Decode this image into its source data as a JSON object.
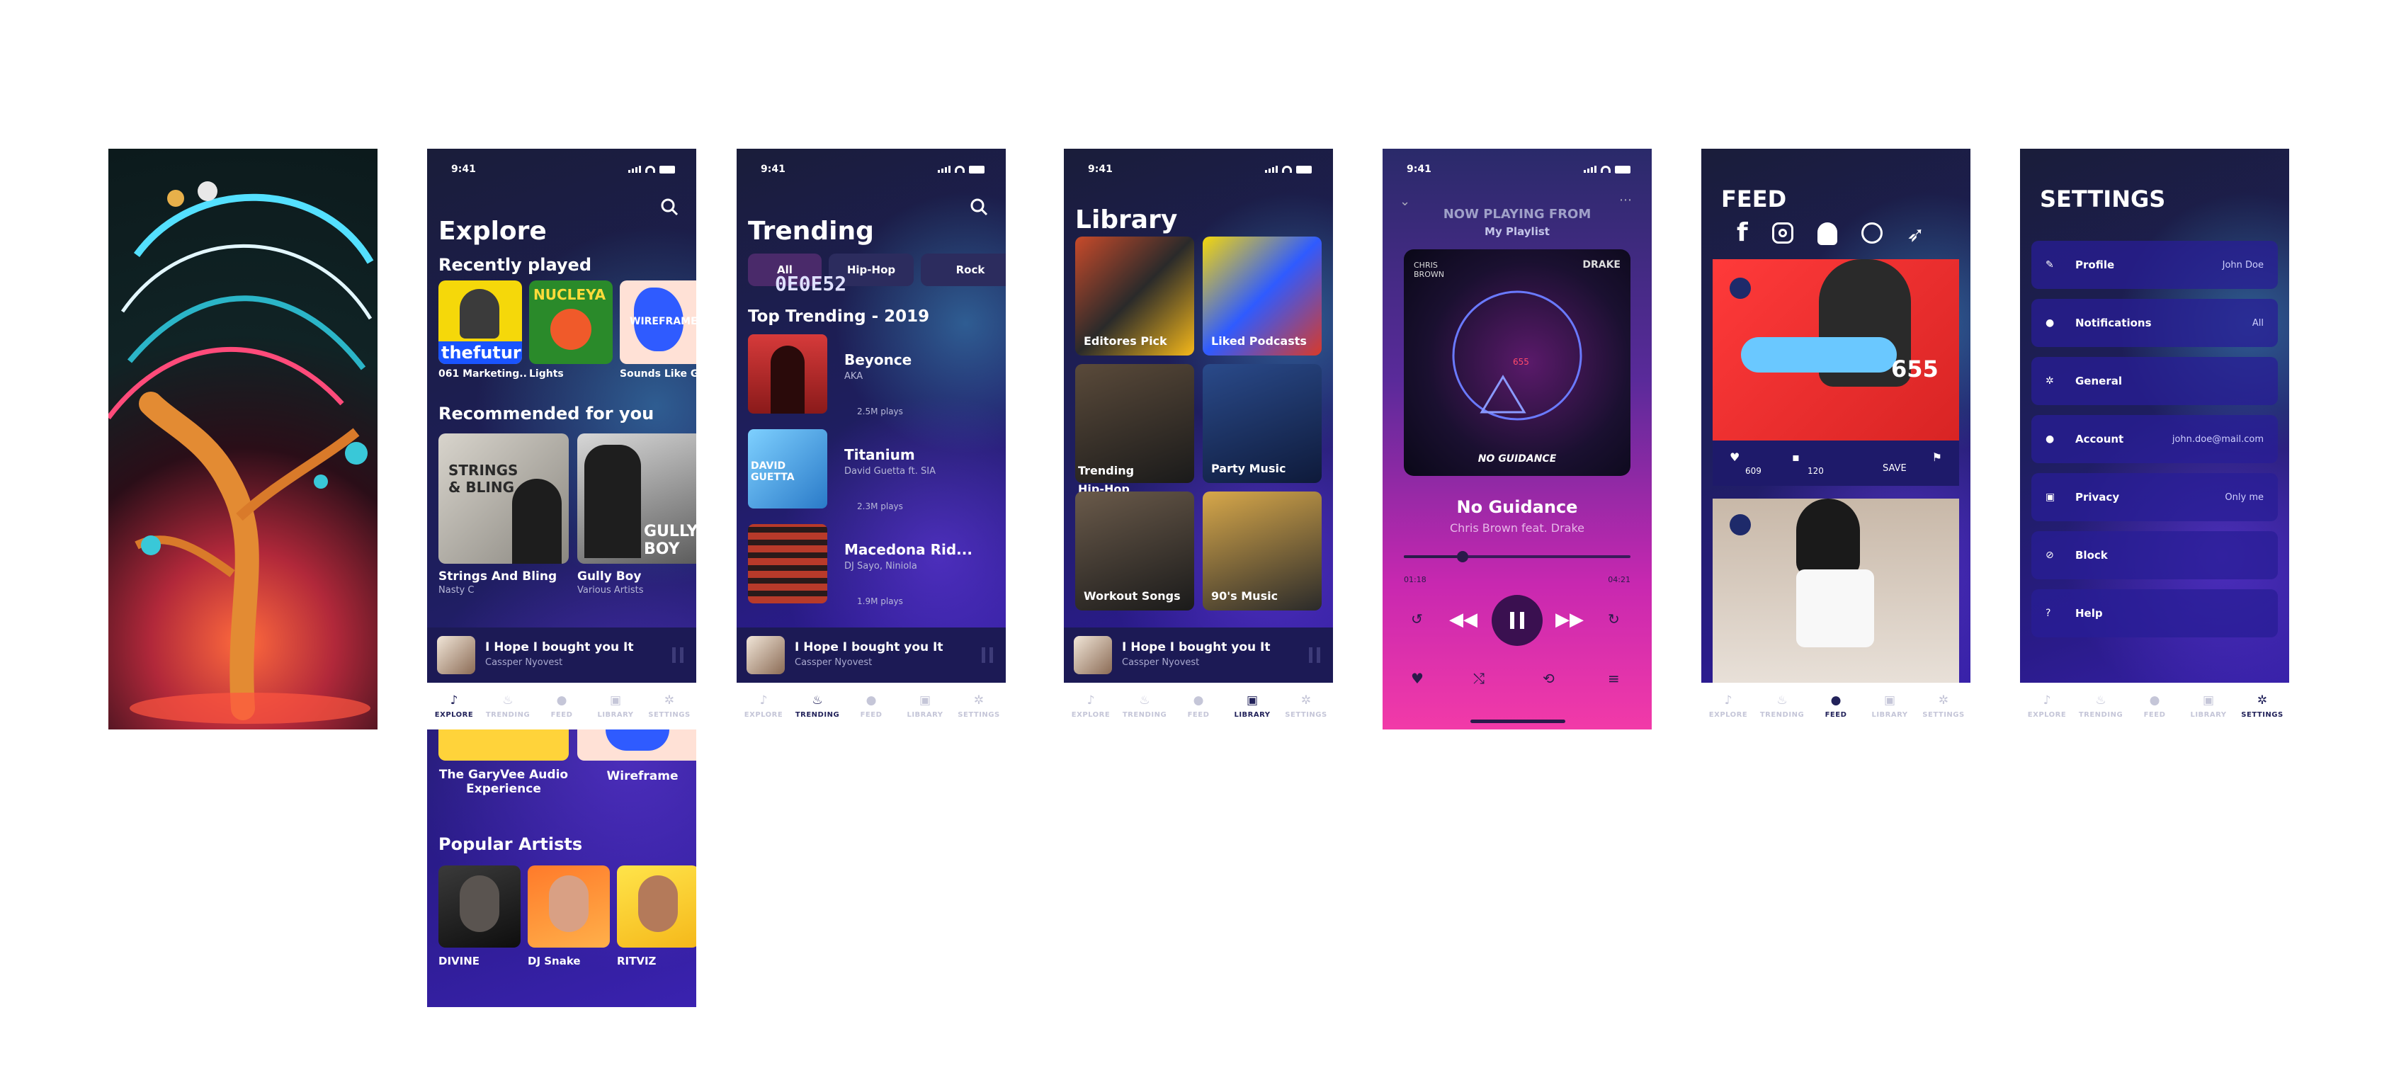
{
  "status_time": "9:41",
  "explore": {
    "title": "Explore",
    "recently_played_heading": "Recently played",
    "recent": [
      {
        "label": "061 Marketing..",
        "art_text": "thefutur"
      },
      {
        "label": "Lights",
        "art_text": "NUCLEYA"
      },
      {
        "label": "Sounds Like G..",
        "art_text": "WIREFRAME"
      }
    ],
    "recommended_heading": "Recommended for you",
    "recommended": [
      {
        "title": "Strings And Bling",
        "artist": "Nasty C",
        "art_text": "STRINGS & BLING"
      },
      {
        "title": "Gully Boy",
        "artist": "Various Artists",
        "art_text": "GULLY BOY"
      }
    ],
    "more": [
      {
        "label": "The GaryVee Audio Experience"
      },
      {
        "label": "Wireframe"
      }
    ],
    "popular_heading": "Popular Artists",
    "artists": [
      "DIVINE",
      "DJ Snake",
      "RITVIZ"
    ]
  },
  "trending": {
    "title": "Trending",
    "pills": [
      "All",
      "Hip-Hop",
      "Rock"
    ],
    "overlay_code": "0E0E52",
    "top_heading": "Top Trending - 2019",
    "tracks": [
      {
        "title": "Beyonce",
        "artist": "AKA",
        "plays": "2.5M plays"
      },
      {
        "title": "Titanium",
        "artist": "David Guetta ft. SIA",
        "plays": "2.3M plays",
        "art_text": "DAVID GUETTA"
      },
      {
        "title": "Macedona Rid...",
        "artist": "DJ Sayo, Niniola",
        "plays": "1.9M plays"
      }
    ]
  },
  "library": {
    "title": "Library",
    "tiles": [
      "Editores Pick",
      "Liked Podcasts",
      "Trending Hip-Hop",
      "Party Music",
      "Workout Songs",
      "90's Music"
    ]
  },
  "now_playing": {
    "header": "NOW PLAYING FROM",
    "playlist": "My Playlist",
    "song": "No Guidance",
    "artist": "Chris Brown feat. Drake",
    "elapsed": "01:18",
    "duration": "04:21",
    "progress": 0.26,
    "art_left": "CHRIS BROWN",
    "art_right": "DRAKE",
    "art_bottom": "NO GUIDANCE",
    "art_number": "655"
  },
  "feed": {
    "title": "FEED",
    "likes": "609",
    "comments": "120",
    "save_label": "SAVE",
    "overlay_number": "655"
  },
  "settings": {
    "title": "SETTINGS",
    "rows": [
      {
        "label": "Profile",
        "value": "John Doe",
        "icon": "pencil-icon"
      },
      {
        "label": "Notifications",
        "value": "All",
        "icon": "bell-icon"
      },
      {
        "label": "General",
        "value": "",
        "icon": "gear-icon"
      },
      {
        "label": "Account",
        "value": "john.doe@mail.com",
        "icon": "user-icon"
      },
      {
        "label": "Privacy",
        "value": "Only me",
        "icon": "lock-icon"
      },
      {
        "label": "Block",
        "value": "",
        "icon": "block-icon"
      },
      {
        "label": "Help",
        "value": "",
        "icon": "help-icon"
      }
    ]
  },
  "miniplayer": {
    "title": "I Hope I bought you It",
    "artist": "Cassper Nyovest"
  },
  "tabs": [
    "EXPLORE",
    "TRENDING",
    "FEED",
    "LIBRARY",
    "SETTINGS"
  ]
}
